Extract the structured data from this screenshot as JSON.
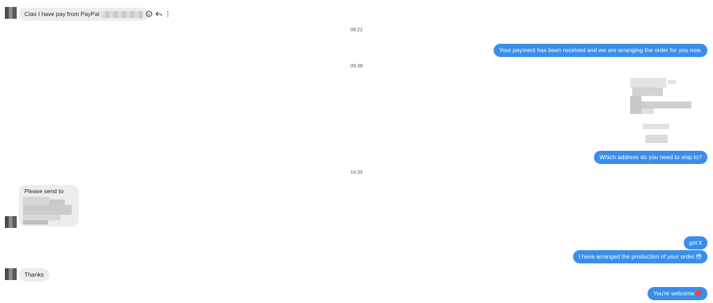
{
  "conversation": {
    "messages": [
      {
        "side": "in",
        "text": "Ciao I have pay from PayPal"
      },
      {
        "side": "time",
        "text": "09:22"
      },
      {
        "side": "out",
        "text": "Your payment has been received and we are arranging the order for you now."
      },
      {
        "side": "time",
        "text": "09:38"
      },
      {
        "side": "out",
        "text": "Which address do you need to ship to?"
      },
      {
        "side": "time",
        "text": "14:33"
      },
      {
        "side": "in",
        "text": "Please send to"
      },
      {
        "side": "out",
        "text": "got it"
      },
      {
        "side": "out",
        "text": "I have arranged the production of your order.😳"
      },
      {
        "side": "in",
        "text": "Thanks"
      },
      {
        "side": "out",
        "text": "You're welcome❤️"
      }
    ]
  },
  "icons": {
    "react": "smiley-icon",
    "reply": "reply-icon",
    "more": "more-vertical-icon"
  }
}
